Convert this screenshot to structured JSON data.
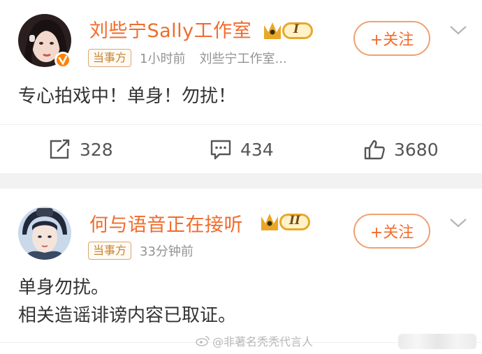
{
  "posts": [
    {
      "author": "刘些宁Sally工作室",
      "badge_level": "I",
      "tag": "当事方",
      "time": "1小时前",
      "source": "刘些宁工作室...",
      "follow_label": "+关注",
      "content": [
        "专心拍戏中！单身！勿扰！"
      ],
      "reposts": "328",
      "comments": "434",
      "likes": "3680"
    },
    {
      "author": "何与语音正在接听",
      "badge_level": "II",
      "tag": "当事方",
      "time": "33分钟前",
      "follow_label": "+关注",
      "content": [
        "单身勿扰。",
        "相关造谣诽谤内容已取证。"
      ]
    }
  ],
  "watermark": "@非著名秃秃代言人",
  "colors": {
    "accent": "#f26b2b",
    "verified": "#ff8200",
    "tag_border": "#d6a775"
  },
  "icons": [
    "verified-icon",
    "crown-badge-icon",
    "chevron-down-icon",
    "repost-icon",
    "comment-icon",
    "like-icon",
    "weibo-logo-icon"
  ]
}
